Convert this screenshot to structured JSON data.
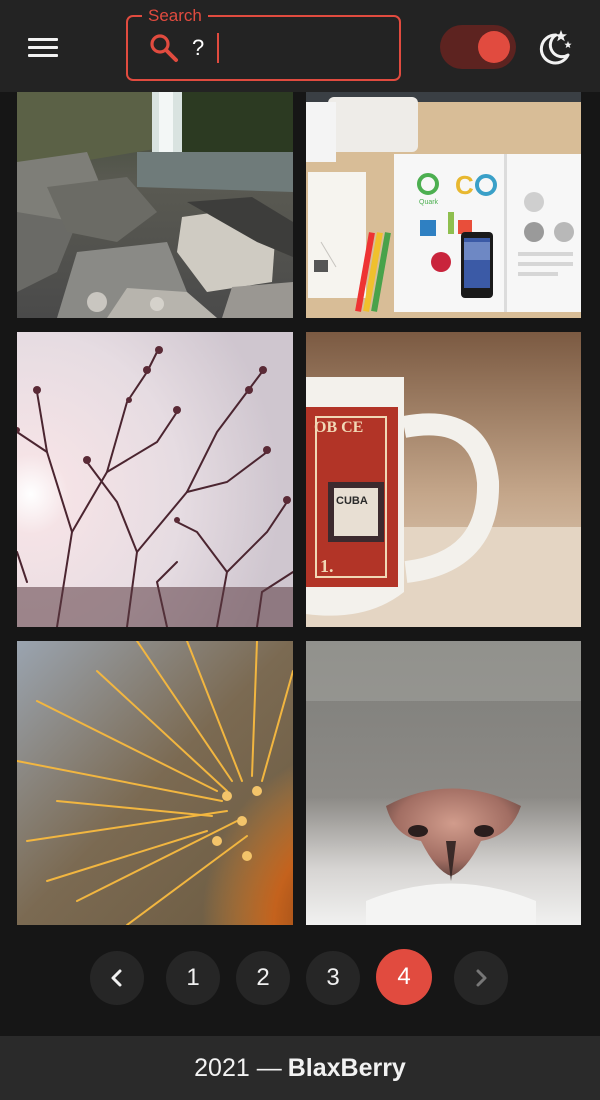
{
  "header": {
    "search": {
      "legend": "Search",
      "value": "?",
      "placeholder": ""
    },
    "toggle": {
      "state": "on"
    },
    "colors": {
      "accent": "#e14b3f",
      "header_bg": "#232323"
    },
    "icons": [
      "menu-icon",
      "search-icon",
      "toggle-switch",
      "night-mode-icon"
    ]
  },
  "gallery": {
    "images": [
      {
        "name": "waterfall-rocks"
      },
      {
        "name": "desk-notebook-phone"
      },
      {
        "name": "tree-branches-sky"
      },
      {
        "name": "stamp-mug"
      },
      {
        "name": "cactus-spines"
      },
      {
        "name": "cat-nose"
      }
    ]
  },
  "pagination": {
    "prev_icon": "chevron-left-icon",
    "next_icon": "chevron-right-icon",
    "pages": [
      "1",
      "2",
      "3",
      "4"
    ],
    "current": "4"
  },
  "footer": {
    "year_text": "2021 —",
    "brand": "BlaxBerry"
  }
}
